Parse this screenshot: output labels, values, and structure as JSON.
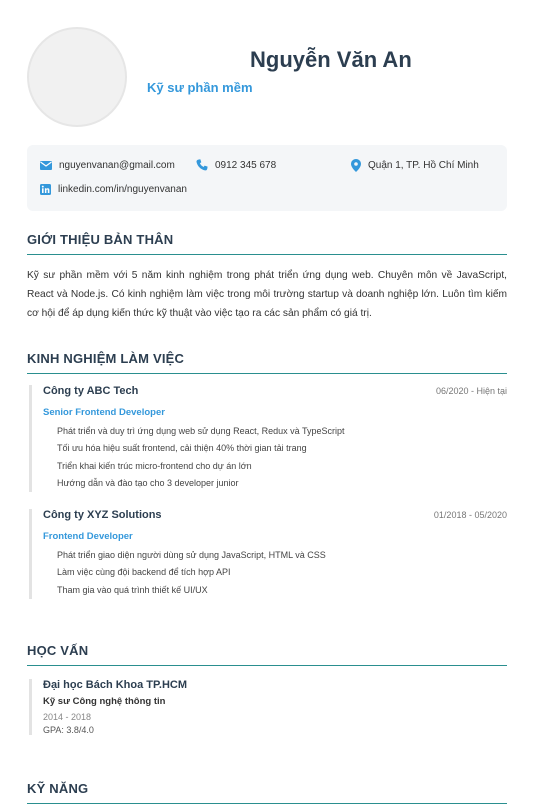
{
  "header": {
    "name": "Nguyễn Văn An",
    "title": "Kỹ sư phần mềm"
  },
  "contact": {
    "email": "nguyenvanan@gmail.com",
    "phone": "0912 345 678",
    "address": "Quận 1, TP. Hồ Chí Minh",
    "linkedin": "linkedin.com/in/nguyenvanan"
  },
  "colors": {
    "accent": "#3498db",
    "heading": "#2c3e50",
    "rule": "#2a8f8f",
    "contact_bg": "#f4f6f8"
  },
  "sections": {
    "summary_title": "GIỚI THIỆU BẢN THÂN",
    "experience_title": "KINH NGHIỆM LÀM VIỆC",
    "education_title": "HỌC VẤN",
    "skills_title": "KỸ NĂNG"
  },
  "summary": "Kỹ sư phần mềm với 5 năm kinh nghiệm trong phát triển ứng dụng web. Chuyên môn về JavaScript, React và Node.js. Có kinh nghiệm làm việc trong môi trường startup và doanh nghiệp lớn. Luôn tìm kiếm cơ hội để áp dụng kiến thức kỹ thuật vào việc tạo ra các sản phẩm có giá trị.",
  "experience": [
    {
      "company": "Công ty ABC Tech",
      "period": "06/2020 - Hiện tại",
      "position": "Senior Frontend Developer",
      "duties": [
        "Phát triển và duy trì ứng dụng web sử dụng React, Redux và TypeScript",
        "Tối ưu hóa hiệu suất frontend, cải thiện 40% thời gian tải trang",
        "Triển khai kiến trúc micro-frontend cho dự án lớn",
        "Hướng dẫn và đào tạo cho 3 developer junior"
      ]
    },
    {
      "company": "Công ty XYZ Solutions",
      "period": "01/2018 - 05/2020",
      "position": "Frontend Developer",
      "duties": [
        "Phát triển giao diện người dùng sử dụng JavaScript, HTML và CSS",
        "Làm việc cùng đội backend để tích hợp API",
        "Tham gia vào quá trình thiết kế UI/UX"
      ]
    }
  ],
  "education": {
    "school": "Đại học Bách Khoa TP.HCM",
    "degree": "Kỹ sư Công nghệ thông tin",
    "years": "2014 - 2018",
    "gpa": "GPA: 3.8/4.0"
  }
}
